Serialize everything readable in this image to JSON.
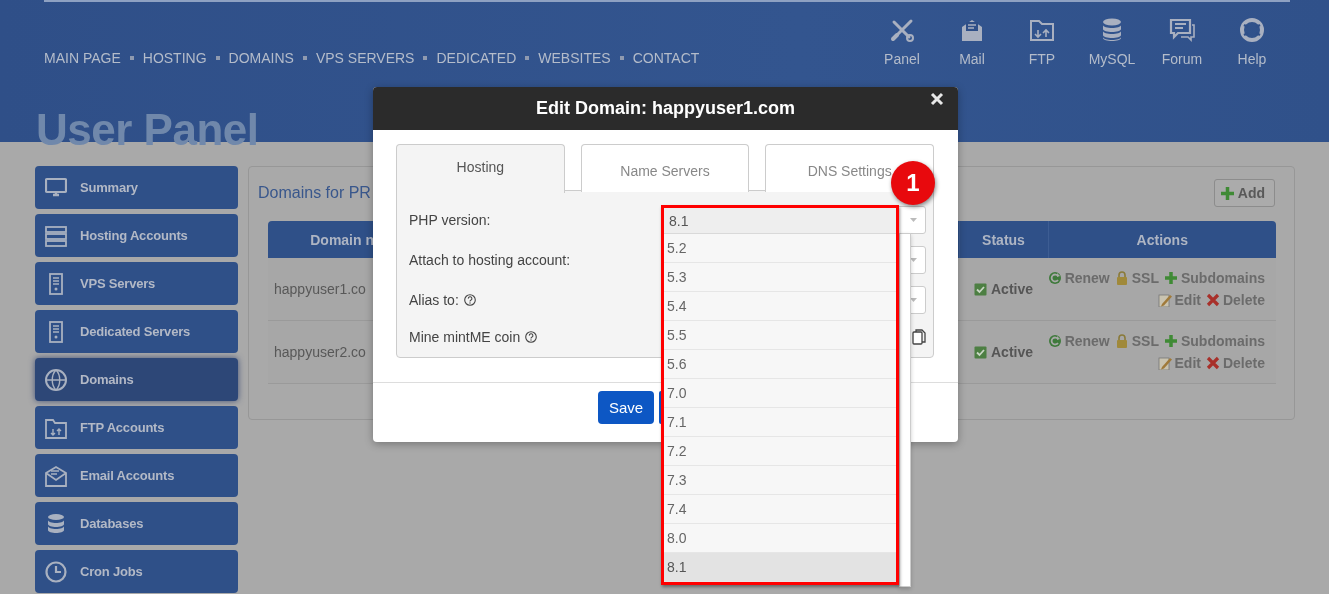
{
  "nav": [
    "MAIN PAGE",
    "HOSTING",
    "DOMAINS",
    "VPS SERVERS",
    "DEDICATED",
    "WEBSITES",
    "CONTACT"
  ],
  "tools": [
    "Panel",
    "Mail",
    "FTP",
    "MySQL",
    "Forum",
    "Help"
  ],
  "page_title": "User Panel",
  "sidebar": [
    {
      "label": "Summary",
      "selected": false
    },
    {
      "label": "Hosting Accounts",
      "selected": false
    },
    {
      "label": "VPS Servers",
      "selected": false
    },
    {
      "label": "Dedicated Servers",
      "selected": false
    },
    {
      "label": "Domains",
      "selected": true
    },
    {
      "label": "FTP Accounts",
      "selected": false
    },
    {
      "label": "Email Accounts",
      "selected": false
    },
    {
      "label": "Databases",
      "selected": false
    },
    {
      "label": "Cron Jobs",
      "selected": false
    }
  ],
  "domains": {
    "title": "Domains for PR",
    "add_button": "Add",
    "columns": [
      "Domain n",
      "Status",
      "Actions"
    ],
    "rows": [
      {
        "domain": "happyuser1.co",
        "status": "Active",
        "action_lines": [
          [
            {
              "kind": "renew",
              "label": "Renew"
            },
            {
              "kind": "ssl",
              "label": "SSL"
            },
            {
              "kind": "add",
              "label": "Subdomains"
            }
          ],
          [
            {
              "kind": "edit",
              "label": "Edit"
            },
            {
              "kind": "delete",
              "label": "Delete"
            }
          ]
        ]
      },
      {
        "domain": "happyuser2.co",
        "status": "Active",
        "action_lines": [
          [
            {
              "kind": "renew",
              "label": "Renew"
            },
            {
              "kind": "ssl",
              "label": "SSL"
            },
            {
              "kind": "add",
              "label": "Subdomains"
            }
          ],
          [
            {
              "kind": "edit",
              "label": "Edit"
            },
            {
              "kind": "delete",
              "label": "Delete"
            }
          ]
        ]
      }
    ]
  },
  "modal": {
    "title": "Edit Domain: happyuser1.com",
    "tabs": [
      {
        "label": "Hosting",
        "selected": true
      },
      {
        "label": "Name Servers",
        "selected": false
      },
      {
        "label": "DNS Settings",
        "selected": false
      }
    ],
    "fields": [
      {
        "label": "PHP version:",
        "kind": "select",
        "help": false
      },
      {
        "label": "Attach to hosting account:",
        "kind": "select",
        "help": false
      },
      {
        "label": "Alias to:",
        "kind": "select",
        "help": true
      },
      {
        "label": "Mine mintME coin",
        "kind": "copy",
        "help": true
      }
    ],
    "php_dropdown": {
      "value": "8.1",
      "options": [
        {
          "label": "5.2",
          "selected": false
        },
        {
          "label": "5.3",
          "selected": false
        },
        {
          "label": "5.4",
          "selected": false
        },
        {
          "label": "5.5",
          "selected": false
        },
        {
          "label": "5.6",
          "selected": false
        },
        {
          "label": "7.0",
          "selected": false
        },
        {
          "label": "7.1",
          "selected": false
        },
        {
          "label": "7.2",
          "selected": false
        },
        {
          "label": "7.3",
          "selected": false
        },
        {
          "label": "7.4",
          "selected": false
        },
        {
          "label": "8.0",
          "selected": false
        },
        {
          "label": "8.1",
          "selected": true
        }
      ]
    },
    "buttons": [
      "Save"
    ]
  },
  "annotation": {
    "badge": "1"
  }
}
